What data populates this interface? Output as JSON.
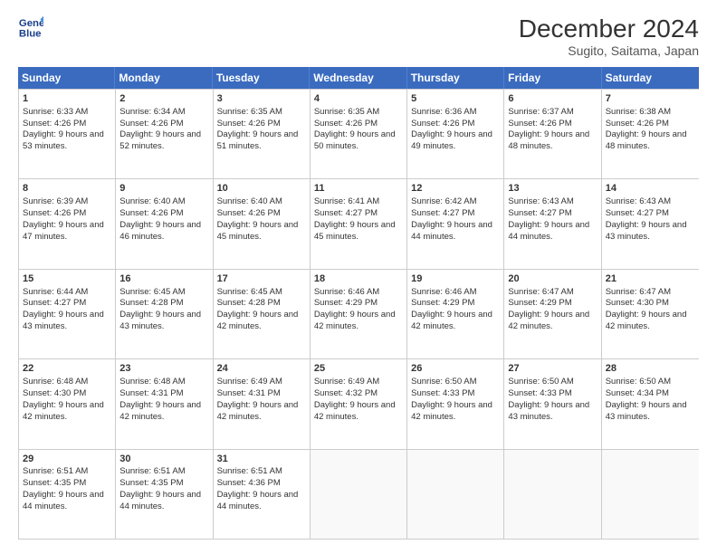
{
  "header": {
    "logo": {
      "line1": "General",
      "line2": "Blue"
    },
    "title": "December 2024",
    "subtitle": "Sugito, Saitama, Japan"
  },
  "weekdays": [
    "Sunday",
    "Monday",
    "Tuesday",
    "Wednesday",
    "Thursday",
    "Friday",
    "Saturday"
  ],
  "weeks": [
    [
      {
        "day": "1",
        "sunrise": "Sunrise: 6:33 AM",
        "sunset": "Sunset: 4:26 PM",
        "daylight": "Daylight: 9 hours and 53 minutes."
      },
      {
        "day": "2",
        "sunrise": "Sunrise: 6:34 AM",
        "sunset": "Sunset: 4:26 PM",
        "daylight": "Daylight: 9 hours and 52 minutes."
      },
      {
        "day": "3",
        "sunrise": "Sunrise: 6:35 AM",
        "sunset": "Sunset: 4:26 PM",
        "daylight": "Daylight: 9 hours and 51 minutes."
      },
      {
        "day": "4",
        "sunrise": "Sunrise: 6:35 AM",
        "sunset": "Sunset: 4:26 PM",
        "daylight": "Daylight: 9 hours and 50 minutes."
      },
      {
        "day": "5",
        "sunrise": "Sunrise: 6:36 AM",
        "sunset": "Sunset: 4:26 PM",
        "daylight": "Daylight: 9 hours and 49 minutes."
      },
      {
        "day": "6",
        "sunrise": "Sunrise: 6:37 AM",
        "sunset": "Sunset: 4:26 PM",
        "daylight": "Daylight: 9 hours and 48 minutes."
      },
      {
        "day": "7",
        "sunrise": "Sunrise: 6:38 AM",
        "sunset": "Sunset: 4:26 PM",
        "daylight": "Daylight: 9 hours and 48 minutes."
      }
    ],
    [
      {
        "day": "8",
        "sunrise": "Sunrise: 6:39 AM",
        "sunset": "Sunset: 4:26 PM",
        "daylight": "Daylight: 9 hours and 47 minutes."
      },
      {
        "day": "9",
        "sunrise": "Sunrise: 6:40 AM",
        "sunset": "Sunset: 4:26 PM",
        "daylight": "Daylight: 9 hours and 46 minutes."
      },
      {
        "day": "10",
        "sunrise": "Sunrise: 6:40 AM",
        "sunset": "Sunset: 4:26 PM",
        "daylight": "Daylight: 9 hours and 45 minutes."
      },
      {
        "day": "11",
        "sunrise": "Sunrise: 6:41 AM",
        "sunset": "Sunset: 4:27 PM",
        "daylight": "Daylight: 9 hours and 45 minutes."
      },
      {
        "day": "12",
        "sunrise": "Sunrise: 6:42 AM",
        "sunset": "Sunset: 4:27 PM",
        "daylight": "Daylight: 9 hours and 44 minutes."
      },
      {
        "day": "13",
        "sunrise": "Sunrise: 6:43 AM",
        "sunset": "Sunset: 4:27 PM",
        "daylight": "Daylight: 9 hours and 44 minutes."
      },
      {
        "day": "14",
        "sunrise": "Sunrise: 6:43 AM",
        "sunset": "Sunset: 4:27 PM",
        "daylight": "Daylight: 9 hours and 43 minutes."
      }
    ],
    [
      {
        "day": "15",
        "sunrise": "Sunrise: 6:44 AM",
        "sunset": "Sunset: 4:27 PM",
        "daylight": "Daylight: 9 hours and 43 minutes."
      },
      {
        "day": "16",
        "sunrise": "Sunrise: 6:45 AM",
        "sunset": "Sunset: 4:28 PM",
        "daylight": "Daylight: 9 hours and 43 minutes."
      },
      {
        "day": "17",
        "sunrise": "Sunrise: 6:45 AM",
        "sunset": "Sunset: 4:28 PM",
        "daylight": "Daylight: 9 hours and 42 minutes."
      },
      {
        "day": "18",
        "sunrise": "Sunrise: 6:46 AM",
        "sunset": "Sunset: 4:29 PM",
        "daylight": "Daylight: 9 hours and 42 minutes."
      },
      {
        "day": "19",
        "sunrise": "Sunrise: 6:46 AM",
        "sunset": "Sunset: 4:29 PM",
        "daylight": "Daylight: 9 hours and 42 minutes."
      },
      {
        "day": "20",
        "sunrise": "Sunrise: 6:47 AM",
        "sunset": "Sunset: 4:29 PM",
        "daylight": "Daylight: 9 hours and 42 minutes."
      },
      {
        "day": "21",
        "sunrise": "Sunrise: 6:47 AM",
        "sunset": "Sunset: 4:30 PM",
        "daylight": "Daylight: 9 hours and 42 minutes."
      }
    ],
    [
      {
        "day": "22",
        "sunrise": "Sunrise: 6:48 AM",
        "sunset": "Sunset: 4:30 PM",
        "daylight": "Daylight: 9 hours and 42 minutes."
      },
      {
        "day": "23",
        "sunrise": "Sunrise: 6:48 AM",
        "sunset": "Sunset: 4:31 PM",
        "daylight": "Daylight: 9 hours and 42 minutes."
      },
      {
        "day": "24",
        "sunrise": "Sunrise: 6:49 AM",
        "sunset": "Sunset: 4:31 PM",
        "daylight": "Daylight: 9 hours and 42 minutes."
      },
      {
        "day": "25",
        "sunrise": "Sunrise: 6:49 AM",
        "sunset": "Sunset: 4:32 PM",
        "daylight": "Daylight: 9 hours and 42 minutes."
      },
      {
        "day": "26",
        "sunrise": "Sunrise: 6:50 AM",
        "sunset": "Sunset: 4:33 PM",
        "daylight": "Daylight: 9 hours and 42 minutes."
      },
      {
        "day": "27",
        "sunrise": "Sunrise: 6:50 AM",
        "sunset": "Sunset: 4:33 PM",
        "daylight": "Daylight: 9 hours and 43 minutes."
      },
      {
        "day": "28",
        "sunrise": "Sunrise: 6:50 AM",
        "sunset": "Sunset: 4:34 PM",
        "daylight": "Daylight: 9 hours and 43 minutes."
      }
    ],
    [
      {
        "day": "29",
        "sunrise": "Sunrise: 6:51 AM",
        "sunset": "Sunset: 4:35 PM",
        "daylight": "Daylight: 9 hours and 44 minutes."
      },
      {
        "day": "30",
        "sunrise": "Sunrise: 6:51 AM",
        "sunset": "Sunset: 4:35 PM",
        "daylight": "Daylight: 9 hours and 44 minutes."
      },
      {
        "day": "31",
        "sunrise": "Sunrise: 6:51 AM",
        "sunset": "Sunset: 4:36 PM",
        "daylight": "Daylight: 9 hours and 44 minutes."
      },
      null,
      null,
      null,
      null
    ]
  ]
}
